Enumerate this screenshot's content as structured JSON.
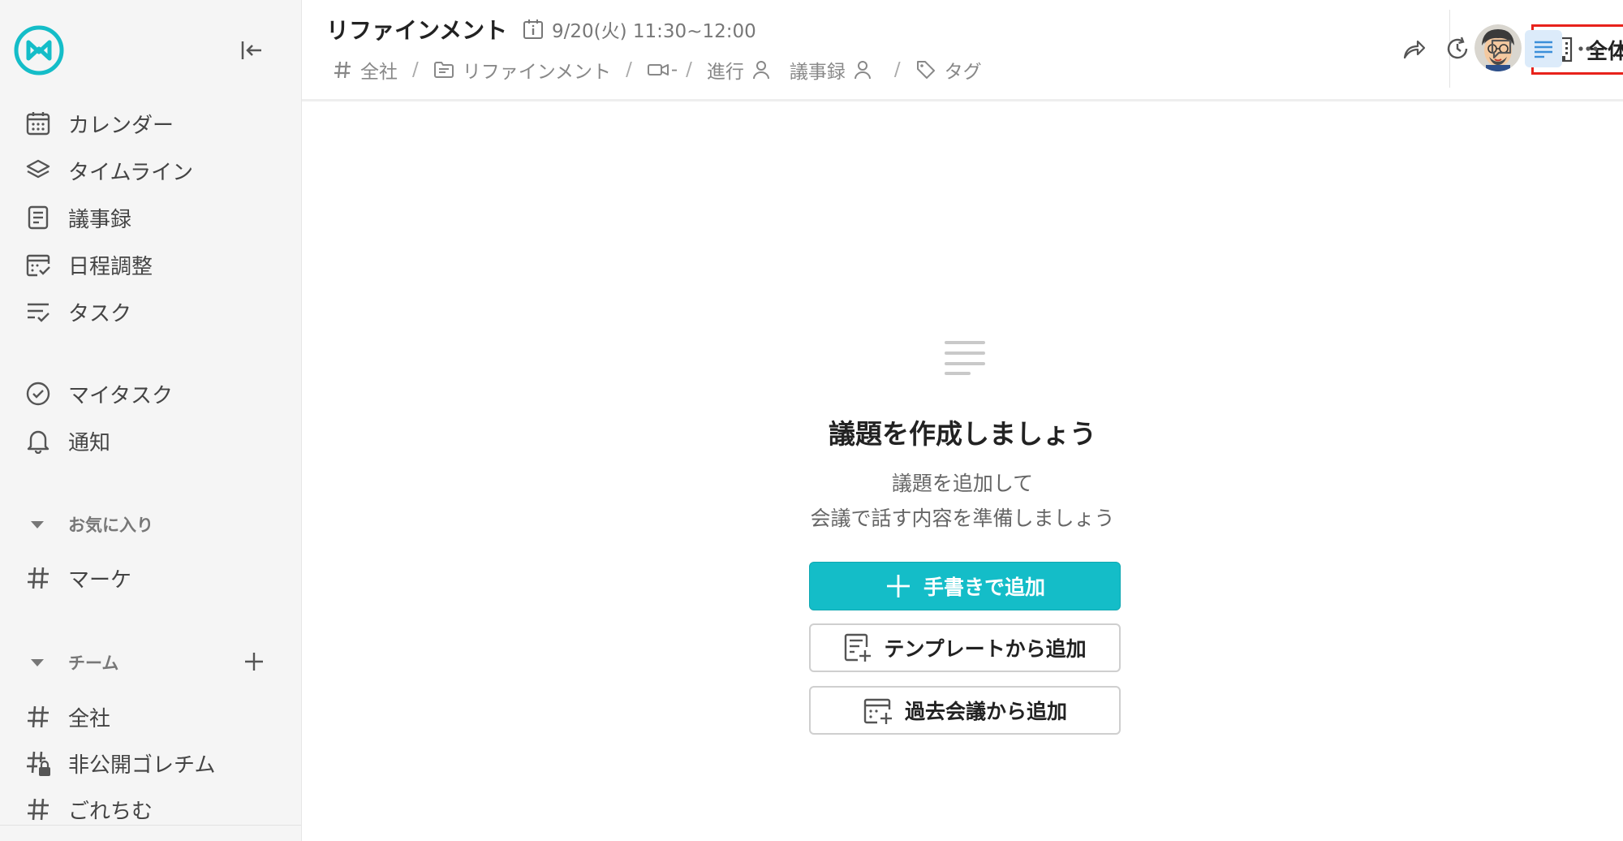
{
  "sidebar": {
    "nav": [
      {
        "label": "カレンダー",
        "icon": "calendar-icon"
      },
      {
        "label": "タイムライン",
        "icon": "layers-icon"
      },
      {
        "label": "議事録",
        "icon": "document-icon"
      },
      {
        "label": "日程調整",
        "icon": "calendar-check-icon"
      },
      {
        "label": "タスク",
        "icon": "task-list-icon"
      }
    ],
    "personal": [
      {
        "label": "マイタスク",
        "icon": "check-circle-icon"
      },
      {
        "label": "通知",
        "icon": "bell-icon"
      }
    ],
    "favorites_label": "お気に入り",
    "favorites": [
      {
        "label": "マーケ",
        "icon": "hash-icon"
      }
    ],
    "teams_label": "チーム",
    "teams": [
      {
        "label": "全社",
        "icon": "hash-icon"
      },
      {
        "label": "非公開ゴレチム",
        "icon": "hash-lock-icon"
      },
      {
        "label": "ごれちむ",
        "icon": "hash-icon"
      }
    ]
  },
  "header": {
    "title": "リファインメント",
    "datetime": "9/20(火) 11:30~12:00",
    "meta": {
      "channel": "全社",
      "folder": "リファインメント",
      "video": "-",
      "facilitator": "進行",
      "minutes_taker": "議事録",
      "tags": "タグ"
    },
    "visibility_label": "全体公開",
    "colors": {
      "highlight_border": "#e8221b",
      "active_bg": "#dcebfa",
      "active_icon": "#3b8fd9"
    }
  },
  "empty_state": {
    "title": "議題を作成しましょう",
    "subtitle_line1": "議題を追加して",
    "subtitle_line2": "会議で話す内容を準備しましょう",
    "add_manual": "手書きで追加",
    "add_template": "テンプレートから追加",
    "add_past": "過去会議から追加",
    "primary_color": "#14bdc8"
  }
}
